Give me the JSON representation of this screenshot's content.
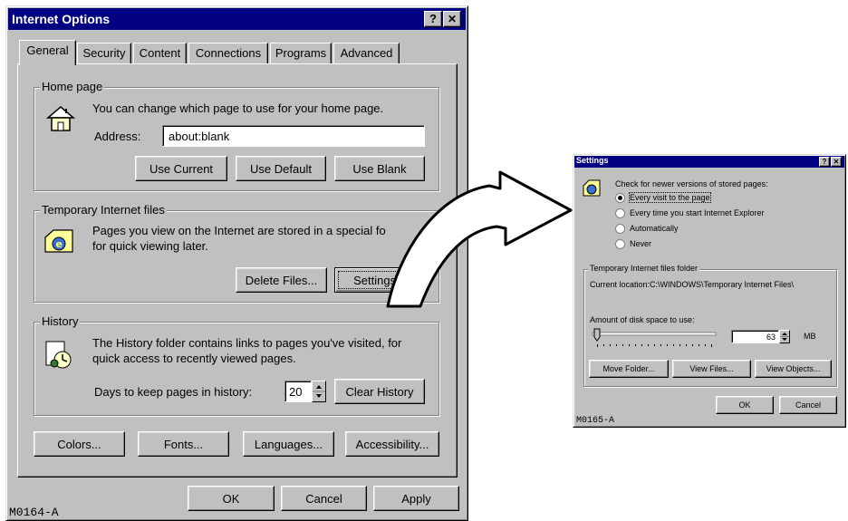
{
  "main_dialog": {
    "title": "Internet Options",
    "help_btn": "?",
    "close_btn": "✕",
    "tabs": [
      "General",
      "Security",
      "Content",
      "Connections",
      "Programs",
      "Advanced"
    ],
    "home_page": {
      "legend": "Home page",
      "desc": "You can change which page to use for your home page.",
      "address_label": "Address:",
      "address_value": "about:blank",
      "use_current": "Use Current",
      "use_default": "Use Default",
      "use_blank": "Use Blank"
    },
    "temp_files": {
      "legend": "Temporary Internet files",
      "desc_line1": "Pages you view on the Internet are stored in a special fo",
      "desc_line2": "for quick viewing later.",
      "delete_files": "Delete Files...",
      "settings": "Settings..."
    },
    "history": {
      "legend": "History",
      "desc_line1": "The History folder contains links to pages you've visited, for",
      "desc_line2": "quick access to recently viewed pages.",
      "days_label": "Days to keep pages in history:",
      "days_value": "20",
      "clear_history": "Clear History"
    },
    "bottom_buttons": {
      "colors": "Colors...",
      "fonts": "Fonts...",
      "languages": "Languages...",
      "accessibility": "Accessibility..."
    },
    "ok": "OK",
    "cancel": "Cancel",
    "apply": "Apply",
    "figure_code": "M0164-A"
  },
  "settings_dialog": {
    "title": "Settings",
    "help_btn": "?",
    "close_btn": "✕",
    "check_label": "Check for newer versions of stored pages:",
    "options": [
      "Every visit to the page",
      "Every time you start Internet Explorer",
      "Automatically",
      "Never"
    ],
    "selected_option_index": 0,
    "folder_legend": "Temporary Internet files folder",
    "current_location": "Current location:C:\\WINDOWS\\Temporary Internet Files\\",
    "disk_space_label": "Amount of disk space to use:",
    "disk_value": "63",
    "disk_unit": "MB",
    "move_folder": "Move Folder...",
    "view_files": "View Files...",
    "view_objects": "View Objects...",
    "ok": "OK",
    "cancel": "Cancel",
    "figure_code": "M0165-A"
  },
  "colors": {
    "titlebar": "#000080",
    "dialog_face": "#c0c0c0"
  }
}
